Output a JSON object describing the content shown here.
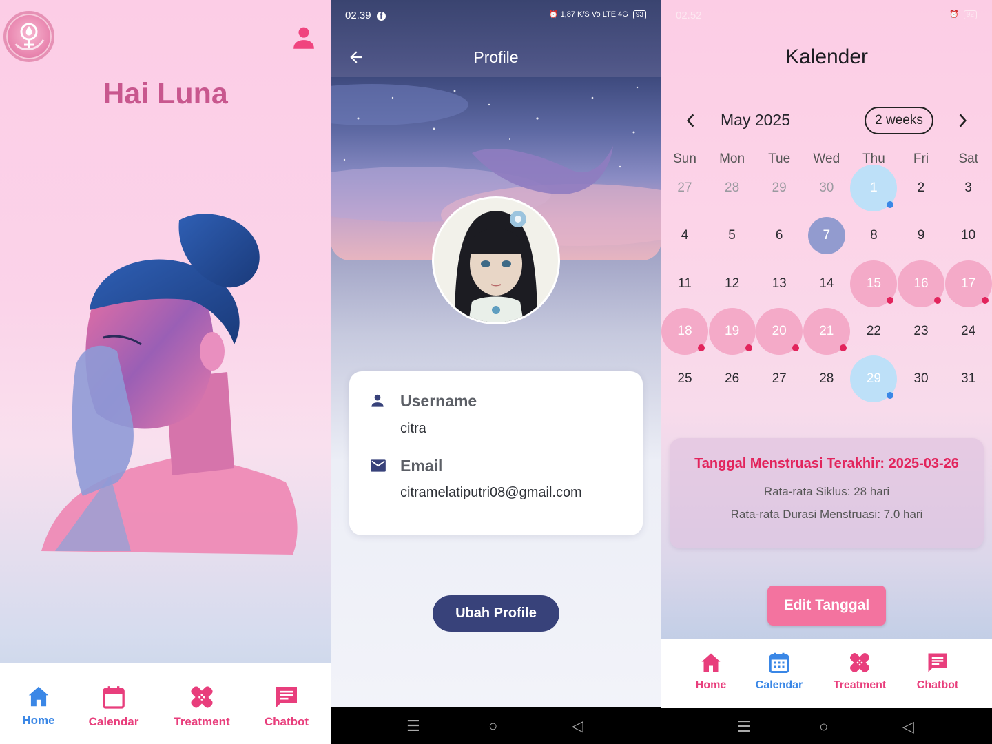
{
  "home": {
    "greeting": "Hai Luna",
    "nav": [
      {
        "label": "Home",
        "icon": "home-icon",
        "color": "#3a87e6"
      },
      {
        "label": "Calendar",
        "icon": "calendar-icon",
        "color": "#e83e7c"
      },
      {
        "label": "Treatment",
        "icon": "treatment-icon",
        "color": "#e83e7c"
      },
      {
        "label": "Chatbot",
        "icon": "chat-icon",
        "color": "#e83e7c"
      }
    ]
  },
  "profile": {
    "status_time": "02.39",
    "status_right": "1,87 K/S  Vo LTE  4G",
    "battery": "93",
    "title": "Profile",
    "username_label": "Username",
    "username_value": "citra",
    "email_label": "Email",
    "email_value": "citramelatiputri08@gmail.com",
    "button": "Ubah Profile"
  },
  "calendar": {
    "status_time": "02.52",
    "battery": "92",
    "title": "Kalender",
    "month": "May 2025",
    "format": "2 weeks",
    "weekdays": [
      "Sun",
      "Mon",
      "Tue",
      "Wed",
      "Thu",
      "Fri",
      "Sat"
    ],
    "weeks": [
      [
        "27",
        "28",
        "29",
        "30",
        "1",
        "2",
        "3"
      ],
      [
        "4",
        "5",
        "6",
        "7",
        "8",
        "9",
        "10"
      ],
      [
        "11",
        "12",
        "13",
        "14",
        "15",
        "16",
        "17"
      ],
      [
        "18",
        "19",
        "20",
        "21",
        "22",
        "23",
        "24"
      ],
      [
        "25",
        "26",
        "27",
        "28",
        "29",
        "30",
        "31"
      ]
    ],
    "last_period": "Tanggal Menstruasi Terakhir: 2025-03-26",
    "avg_cycle": "Rata-rata Siklus: 28 hari",
    "avg_duration": "Rata-rata Durasi Menstruasi: 7.0 hari",
    "edit_button": "Edit Tanggal",
    "nav": [
      {
        "label": "Home",
        "icon": "home-icon",
        "color": "#e83e7c"
      },
      {
        "label": "Calendar",
        "icon": "calendar-icon",
        "color": "#3a87e6"
      },
      {
        "label": "Treatment",
        "icon": "treatment-icon",
        "color": "#e83e7c"
      },
      {
        "label": "Chatbot",
        "icon": "chat-icon",
        "color": "#e83e7c"
      }
    ]
  },
  "colors": {
    "accent_pink": "#e83e7c",
    "accent_blue": "#3a87e6",
    "navy": "#38427a",
    "greeting": "#c8578e"
  }
}
